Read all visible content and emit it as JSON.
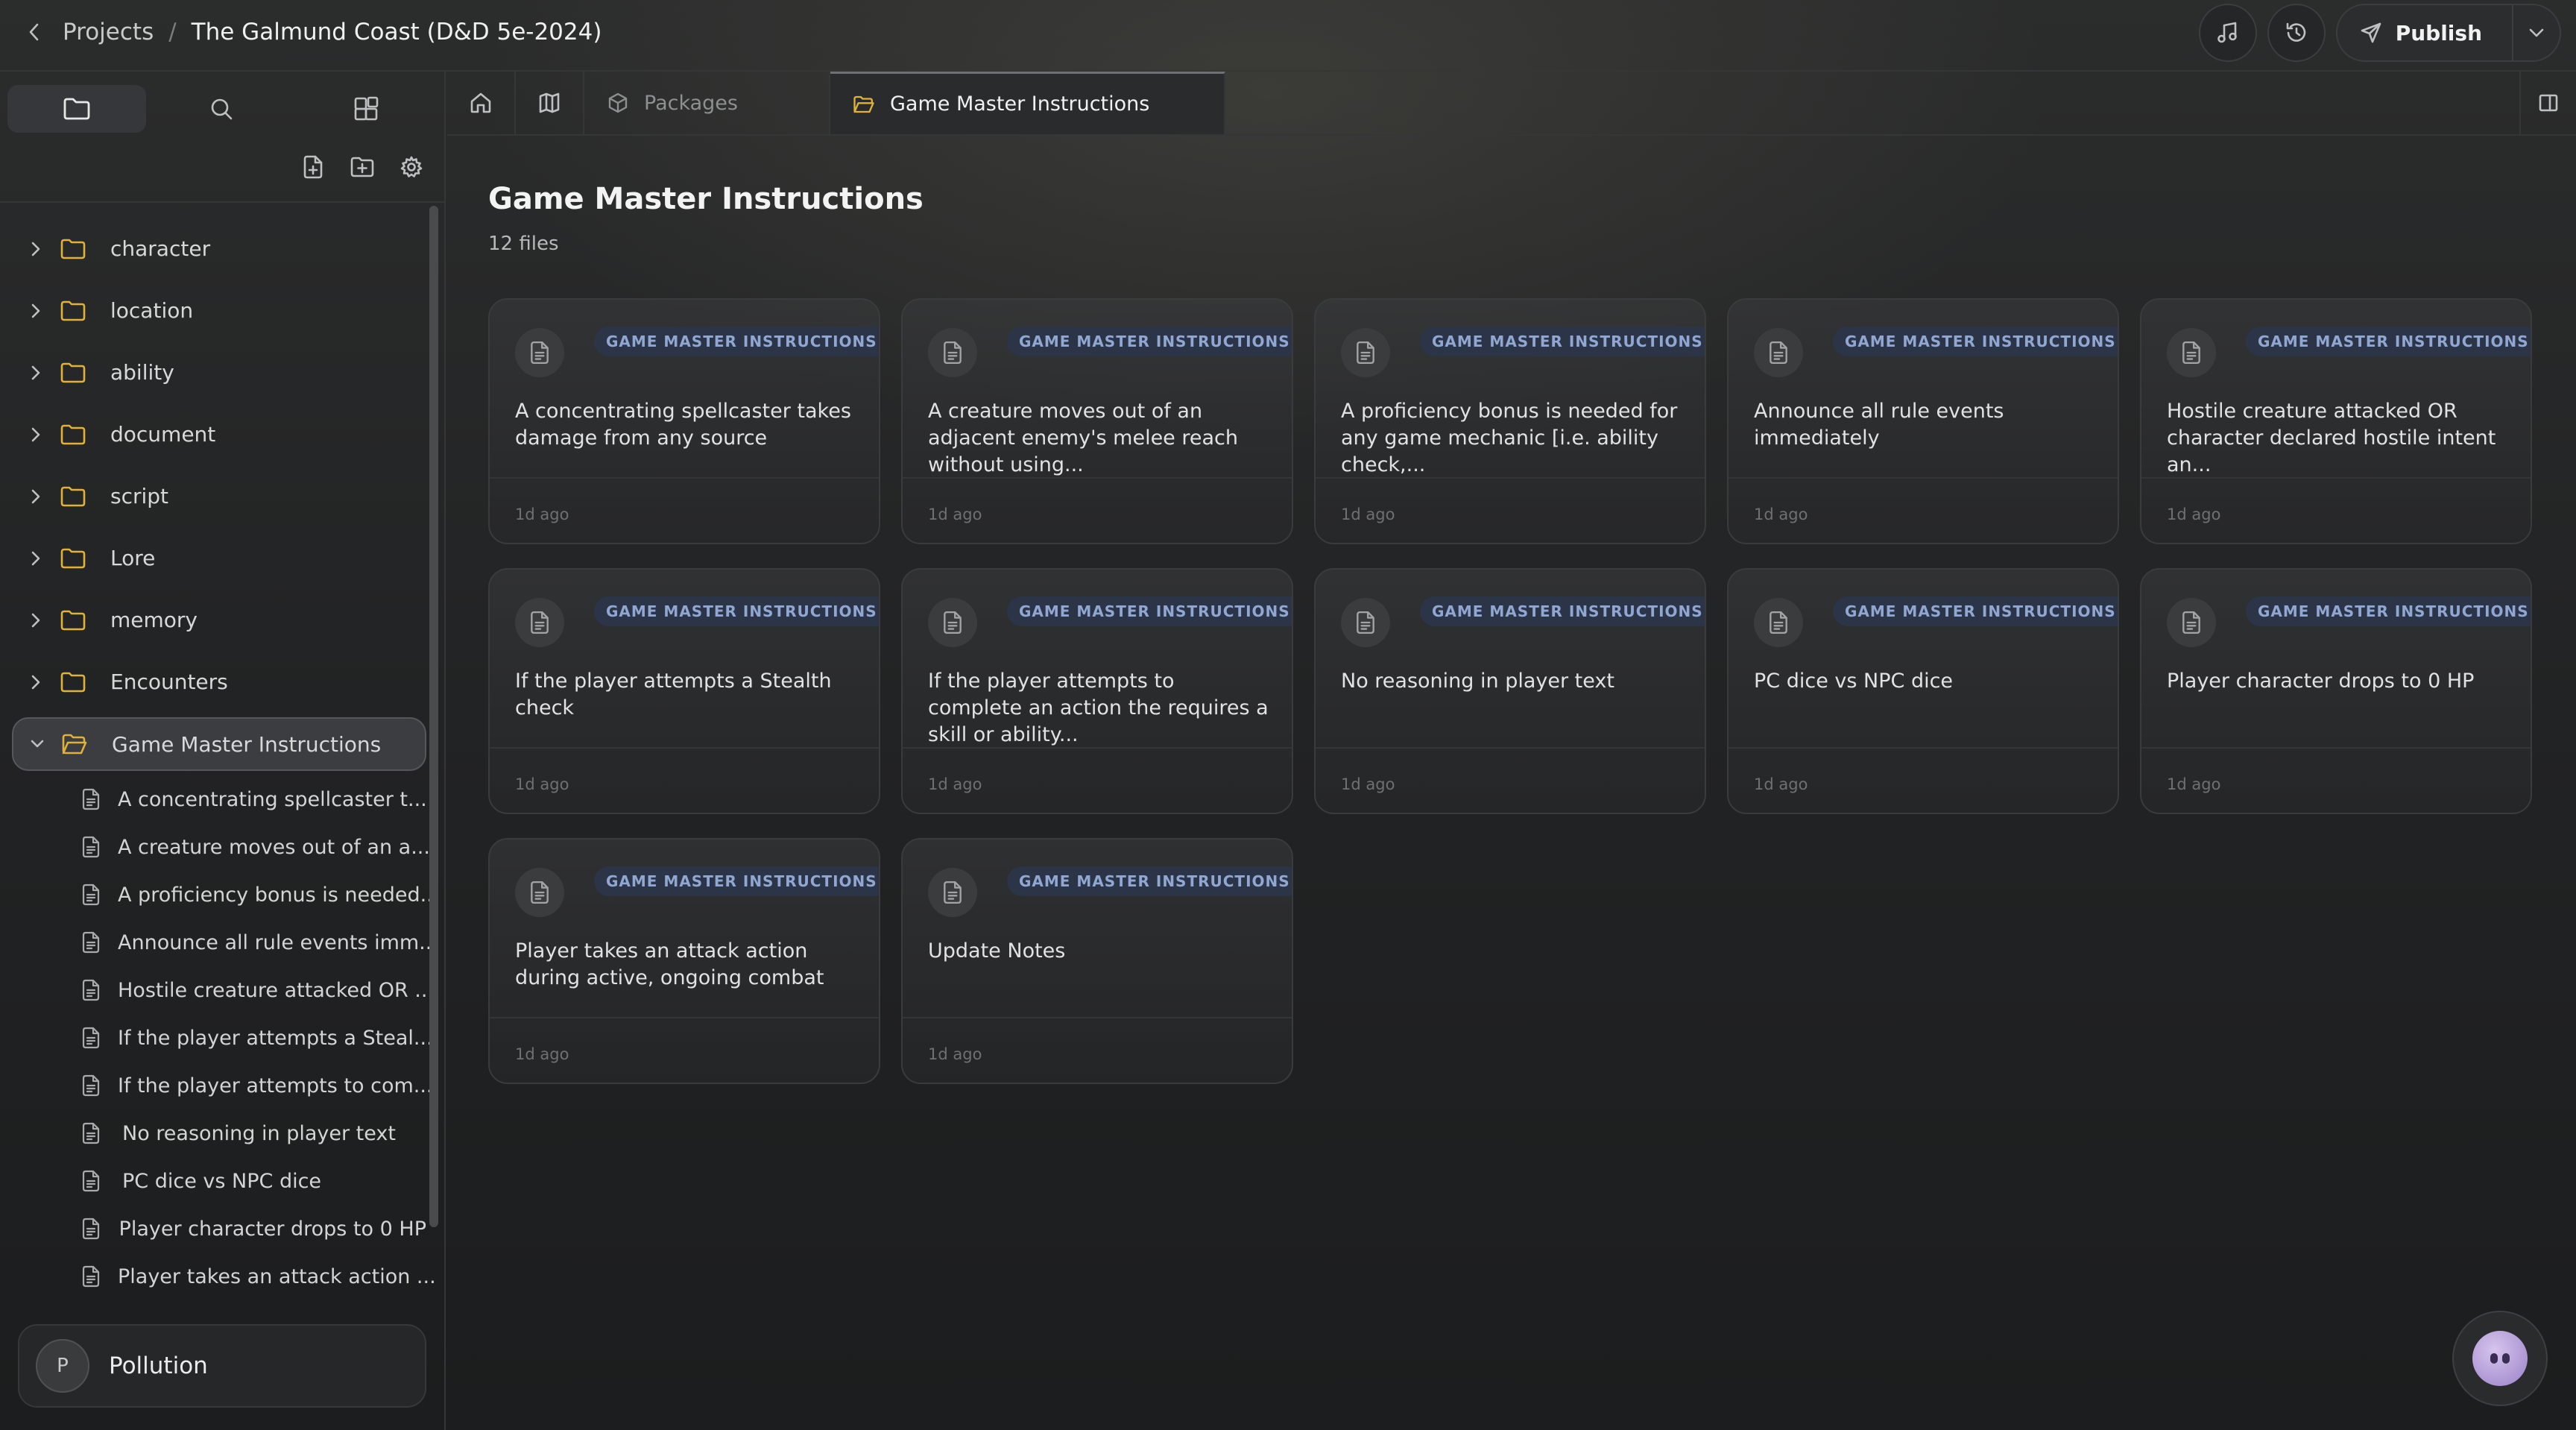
{
  "header": {
    "projects_label": "Projects",
    "separator": "/",
    "project_title": "The Galmund Coast (D&D 5e-2024)",
    "publish_label": "Publish"
  },
  "sidebar": {
    "tabs": [
      "files",
      "search",
      "components"
    ],
    "folders": [
      {
        "label": "character"
      },
      {
        "label": "location"
      },
      {
        "label": "ability"
      },
      {
        "label": "document"
      },
      {
        "label": "script"
      },
      {
        "label": "Lore"
      },
      {
        "label": "memory"
      },
      {
        "label": "Encounters"
      }
    ],
    "open_folder": {
      "label": "Game Master Instructions",
      "files": [
        "A concentrating spellcaster t...",
        "A creature moves out of an a...",
        "A proficiency bonus is needed...",
        "Announce all rule events imm...",
        "Hostile creature attacked OR ...",
        "If the player attempts a Steal...",
        "If the player attempts to com...",
        "No reasoning in player text",
        "PC dice vs NPC dice",
        "Player character drops to 0 HP",
        "Player takes an attack action ..."
      ]
    },
    "user": {
      "initial": "P",
      "name": "Pollution"
    }
  },
  "tabs": {
    "packages": "Packages",
    "active": "Game Master Instructions"
  },
  "main": {
    "title": "Game Master Instructions",
    "file_count": "12 files",
    "cards": [
      {
        "tag": "GAME MASTER INSTRUCTIONS",
        "title": "A concentrating spellcaster takes damage from any source",
        "ago": "1d ago"
      },
      {
        "tag": "GAME MASTER INSTRUCTIONS",
        "title": "A creature moves out of an adjacent enemy's melee reach without using...",
        "ago": "1d ago"
      },
      {
        "tag": "GAME MASTER INSTRUCTIONS",
        "title": "A proficiency bonus is needed for any game mechanic [i.e. ability check,...",
        "ago": "1d ago"
      },
      {
        "tag": "GAME MASTER INSTRUCTIONS",
        "title": "Announce all rule events immediately",
        "ago": "1d ago"
      },
      {
        "tag": "GAME MASTER INSTRUCTIONS",
        "title": "Hostile creature attacked OR character declared hostile intent an...",
        "ago": "1d ago"
      },
      {
        "tag": "GAME MASTER INSTRUCTIONS",
        "title": "If the player attempts a Stealth check",
        "ago": "1d ago"
      },
      {
        "tag": "GAME MASTER INSTRUCTIONS",
        "title": "If the player attempts to complete an action the requires a skill or ability...",
        "ago": "1d ago"
      },
      {
        "tag": "GAME MASTER INSTRUCTIONS",
        "title": "No reasoning in player text",
        "ago": "1d ago"
      },
      {
        "tag": "GAME MASTER INSTRUCTIONS",
        "title": "PC dice vs NPC dice",
        "ago": "1d ago"
      },
      {
        "tag": "GAME MASTER INSTRUCTIONS",
        "title": "Player character drops to 0 HP",
        "ago": "1d ago"
      },
      {
        "tag": "GAME MASTER INSTRUCTIONS",
        "title": "Player takes an attack action during active, ongoing combat",
        "ago": "1d ago"
      },
      {
        "tag": "GAME MASTER INSTRUCTIONS",
        "title": "Update Notes",
        "ago": "1d ago"
      }
    ]
  },
  "colors": {
    "tag_bg": "#2b3547",
    "tag_text": "#90a7d2",
    "folder_icon": "#e0b23a",
    "background": "#232425"
  }
}
